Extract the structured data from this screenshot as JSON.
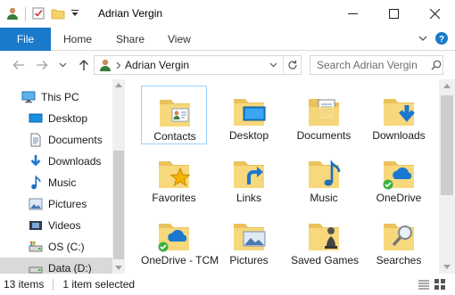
{
  "window": {
    "title": "Adrian Vergin",
    "qat_icons": [
      "user-folder-icon",
      "properties-check-icon",
      "new-folder-icon",
      "customize-qat-dropdown-icon"
    ],
    "controls": [
      "minimize-icon",
      "maximize-icon",
      "close-icon"
    ]
  },
  "ribbon": {
    "tabs": [
      {
        "label": "File"
      },
      {
        "label": "Home"
      },
      {
        "label": "Share"
      },
      {
        "label": "View"
      }
    ],
    "right_icons": [
      "expand-ribbon-icon",
      "help-icon"
    ]
  },
  "navbar": {
    "back_icon": "back-arrow-icon",
    "forward_icon": "forward-arrow-icon",
    "recent_icon": "recent-locations-chevron-icon",
    "up_icon": "up-arrow-icon",
    "address": "Adrian Vergin",
    "address_icon": "user-folder-icon",
    "search_placeholder": "Search Adrian Vergin",
    "search_icon": "search-icon",
    "accent": "#1979ca"
  },
  "sidebar": {
    "items": [
      {
        "label": "This PC",
        "icon": "computer-icon"
      },
      {
        "label": "Desktop",
        "icon": "desktop-icon"
      },
      {
        "label": "Documents",
        "icon": "documents-icon"
      },
      {
        "label": "Downloads",
        "icon": "downloads-icon"
      },
      {
        "label": "Music",
        "icon": "music-icon"
      },
      {
        "label": "Pictures",
        "icon": "pictures-icon"
      },
      {
        "label": "Videos",
        "icon": "videos-icon"
      },
      {
        "label": "OS (C:)",
        "icon": "os-drive-icon"
      },
      {
        "label": "Data (D:)",
        "icon": "drive-icon",
        "selected": true
      }
    ]
  },
  "content": {
    "items": [
      {
        "label": "Contacts",
        "icon": "contacts-folder-icon",
        "focused": true
      },
      {
        "label": "Desktop",
        "icon": "desktop-folder-icon"
      },
      {
        "label": "Documents",
        "icon": "documents-folder-icon"
      },
      {
        "label": "Downloads",
        "icon": "downloads-folder-icon"
      },
      {
        "label": "Favorites",
        "icon": "favorites-folder-icon"
      },
      {
        "label": "Links",
        "icon": "links-folder-icon"
      },
      {
        "label": "Music",
        "icon": "music-folder-icon"
      },
      {
        "label": "OneDrive",
        "icon": "onedrive-folder-icon"
      },
      {
        "label": "OneDrive - TCM",
        "icon": "onedrive-tcm-folder-icon"
      },
      {
        "label": "Pictures",
        "icon": "pictures-folder-icon"
      },
      {
        "label": "Saved Games",
        "icon": "saved-games-folder-icon"
      },
      {
        "label": "Searches",
        "icon": "searches-folder-icon"
      }
    ]
  },
  "status": {
    "count": "13 items",
    "selected": "1 item selected",
    "view_icons": [
      "details-view-icon",
      "large-icons-view-icon"
    ]
  }
}
